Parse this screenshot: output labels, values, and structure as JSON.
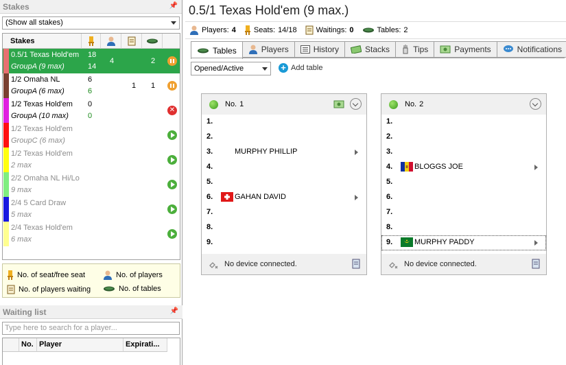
{
  "stakes_panel": {
    "title": "Stakes",
    "filter": "(Show all stakes)",
    "column_name": "Stakes",
    "rows": [
      {
        "name": "0.5/1 Texas Hold'em",
        "group": "GroupA (9 max)",
        "seats": "18",
        "free": "14",
        "players": "4",
        "tables": "2",
        "color": "#e87070",
        "state": "pause",
        "selected": true
      },
      {
        "name": "1/2 Omaha NL",
        "group": "GroupA (6 max)",
        "seats": "6",
        "free": "6",
        "players": "1",
        "tables": "1",
        "color": "#7a4030",
        "state": "pause"
      },
      {
        "name": "1/2 Texas Hold'em",
        "group": "GroupA (10 max)",
        "seats": "0",
        "free": "0",
        "players": "",
        "tables": "",
        "color": "#e020e0",
        "state": "stop"
      },
      {
        "name": "1/2 Texas Hold'em",
        "group": "GroupC (6 max)",
        "seats": "",
        "free": "",
        "players": "",
        "tables": "",
        "color": "#ff1010",
        "state": "play",
        "dim": true
      },
      {
        "name": "1/2 Texas Hold'em",
        "group": "2 max",
        "seats": "",
        "free": "",
        "players": "",
        "tables": "",
        "color": "#ffff10",
        "state": "play",
        "dim": true
      },
      {
        "name": "2/2 Omaha NL Hi/Lo",
        "group": "9 max",
        "seats": "",
        "free": "",
        "players": "",
        "tables": "",
        "color": "#80ee80",
        "state": "play",
        "dim": true
      },
      {
        "name": "2/4 5 Card Draw",
        "group": "5 max",
        "seats": "",
        "free": "",
        "players": "",
        "tables": "",
        "color": "#1818e0",
        "state": "play",
        "dim": true
      },
      {
        "name": "2/4 Texas Hold'em",
        "group": "6 max",
        "seats": "",
        "free": "",
        "players": "",
        "tables": "",
        "color": "#ffff90",
        "state": "play",
        "dim": true
      }
    ],
    "legend": {
      "seat": "No. of seat/free seat",
      "players": "No. of players",
      "waiting": "No. of players waiting",
      "tables": "No. of tables"
    }
  },
  "waiting_panel": {
    "title": "Waiting list",
    "search_placeholder": "Type here to search for a player...",
    "columns": [
      "No.",
      "Player",
      "Expirati..."
    ]
  },
  "main": {
    "title": "0.5/1 Texas Hold'em (9 max.)",
    "stats": {
      "players_label": "Players:",
      "players": "4",
      "seats_label": "Seats:",
      "seats": "14/18",
      "waitings_label": "Waitings:",
      "waitings": "0",
      "tables_label": "Tables:",
      "tables": "2"
    },
    "tabs": [
      "Tables",
      "Players",
      "History",
      "Stacks",
      "Tips",
      "Payments",
      "Notifications"
    ],
    "filter": "Opened/Active",
    "add_table": "Add table",
    "cards": [
      {
        "no_label": "No.",
        "no": "1",
        "footer": "No device connected.",
        "seats": [
          {
            "n": "1.",
            "name": ""
          },
          {
            "n": "2.",
            "name": ""
          },
          {
            "n": "3.",
            "name": "MURPHY PHILLIP",
            "flag": "none"
          },
          {
            "n": "4.",
            "name": ""
          },
          {
            "n": "5.",
            "name": ""
          },
          {
            "n": "6.",
            "name": "GAHAN DAVID",
            "flag": "swiss"
          },
          {
            "n": "7.",
            "name": ""
          },
          {
            "n": "8.",
            "name": ""
          },
          {
            "n": "9.",
            "name": ""
          }
        ]
      },
      {
        "no_label": "No.",
        "no": "2",
        "footer": "No device connected.",
        "seats": [
          {
            "n": "1.",
            "name": ""
          },
          {
            "n": "2.",
            "name": ""
          },
          {
            "n": "3.",
            "name": ""
          },
          {
            "n": "4.",
            "name": "BLOGGS JOE",
            "flag": "andorra"
          },
          {
            "n": "5.",
            "name": ""
          },
          {
            "n": "6.",
            "name": ""
          },
          {
            "n": "7.",
            "name": ""
          },
          {
            "n": "8.",
            "name": ""
          },
          {
            "n": "9.",
            "name": "MURPHY PADDY",
            "flag": "mauritania"
          }
        ]
      }
    ]
  }
}
